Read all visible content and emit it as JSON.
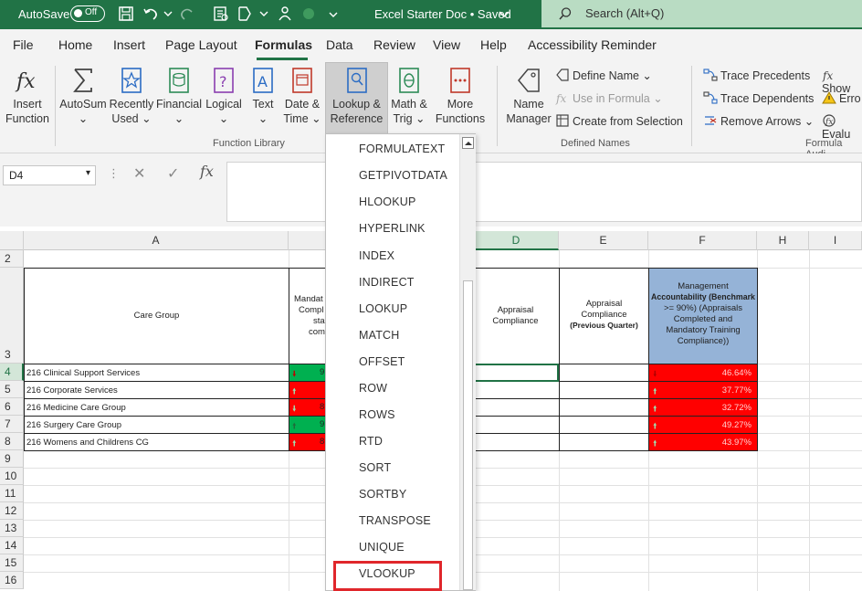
{
  "titlebar": {
    "autosave_label": "AutoSave",
    "autosave_state": "Off",
    "doc_title": "Excel Starter Doc • Saved",
    "search_placeholder": "Search (Alt+Q)"
  },
  "tabs": [
    "File",
    "Home",
    "Insert",
    "Page Layout",
    "Formulas",
    "Data",
    "Review",
    "View",
    "Help",
    "Accessibility Reminder"
  ],
  "active_tab": "Formulas",
  "ribbon": {
    "function_library": {
      "label": "Function Library",
      "insert_function": [
        "Insert",
        "Function"
      ],
      "autosum": "AutoSum",
      "recently_used": [
        "Recently",
        "Used"
      ],
      "financial": "Financial",
      "logical": "Logical",
      "text": "Text",
      "date_time": [
        "Date &",
        "Time"
      ],
      "lookup_reference": [
        "Lookup &",
        "Reference"
      ],
      "math_trig": [
        "Math &",
        "Trig"
      ],
      "more_functions": [
        "More",
        "Functions"
      ]
    },
    "defined_names": {
      "label": "Defined Names",
      "name_manager": [
        "Name",
        "Manager"
      ],
      "define_name": "Define Name",
      "use_in_formula": "Use in Formula",
      "create_from_selection": "Create from Selection"
    },
    "formula_auditing": {
      "label": "Formula Audi",
      "trace_precedents": "Trace Precedents",
      "trace_dependents": "Trace Dependents",
      "remove_arrows": "Remove Arrows",
      "show": "Show",
      "error": "Erro",
      "evaluate": "Evalu"
    }
  },
  "formula_bar": {
    "name_box": "D4",
    "fx": "fx"
  },
  "columns": [
    "A",
    "",
    "D",
    "E",
    "F",
    "H",
    "I"
  ],
  "rows": [
    "2",
    "3",
    "4",
    "5",
    "6",
    "7",
    "8",
    "9",
    "10",
    "11",
    "12",
    "13",
    "14",
    "15",
    "16"
  ],
  "table": {
    "header_care_group": "Care Group",
    "header_mandatory": [
      "Mandat",
      "Compl",
      "sta",
      "com"
    ],
    "header_appraisal": [
      "Appraisal",
      "Compliance"
    ],
    "header_appraisal_prev": [
      "Appraisal",
      "Compliance",
      "(Previous Quarter)"
    ],
    "header_management": [
      "Management",
      "Accountability (Benchmark",
      ">= 90%) (Appraisals",
      "Completed and",
      "Mandatory Training",
      "Compliance))"
    ],
    "care_groups": [
      "216 Clinical Support Services",
      "216 Corporate Services",
      "216 Medicine Care Group",
      "216 Surgery Care Group",
      "216 Womens and Childrens CG"
    ],
    "mandatory_values": [
      "9",
      "",
      "8",
      "9",
      "8"
    ],
    "management_values": [
      "46.64%",
      "37.77%",
      "32.72%",
      "49.27%",
      "43.97%"
    ]
  },
  "dropdown_items": [
    "FORMULATEXT",
    "GETPIVOTDATA",
    "HLOOKUP",
    "HYPERLINK",
    "INDEX",
    "INDIRECT",
    "LOOKUP",
    "MATCH",
    "OFFSET",
    "ROW",
    "ROWS",
    "RTD",
    "SORT",
    "SORTBY",
    "TRANSPOSE",
    "UNIQUE",
    "VLOOKUP"
  ],
  "highlighted_item": "VLOOKUP",
  "colors": {
    "excel_green": "#217346",
    "red_cell": "#ff0000",
    "green_cell": "#00b050",
    "blue_header": "#95b3d7",
    "highlight_border": "#e0262b"
  }
}
